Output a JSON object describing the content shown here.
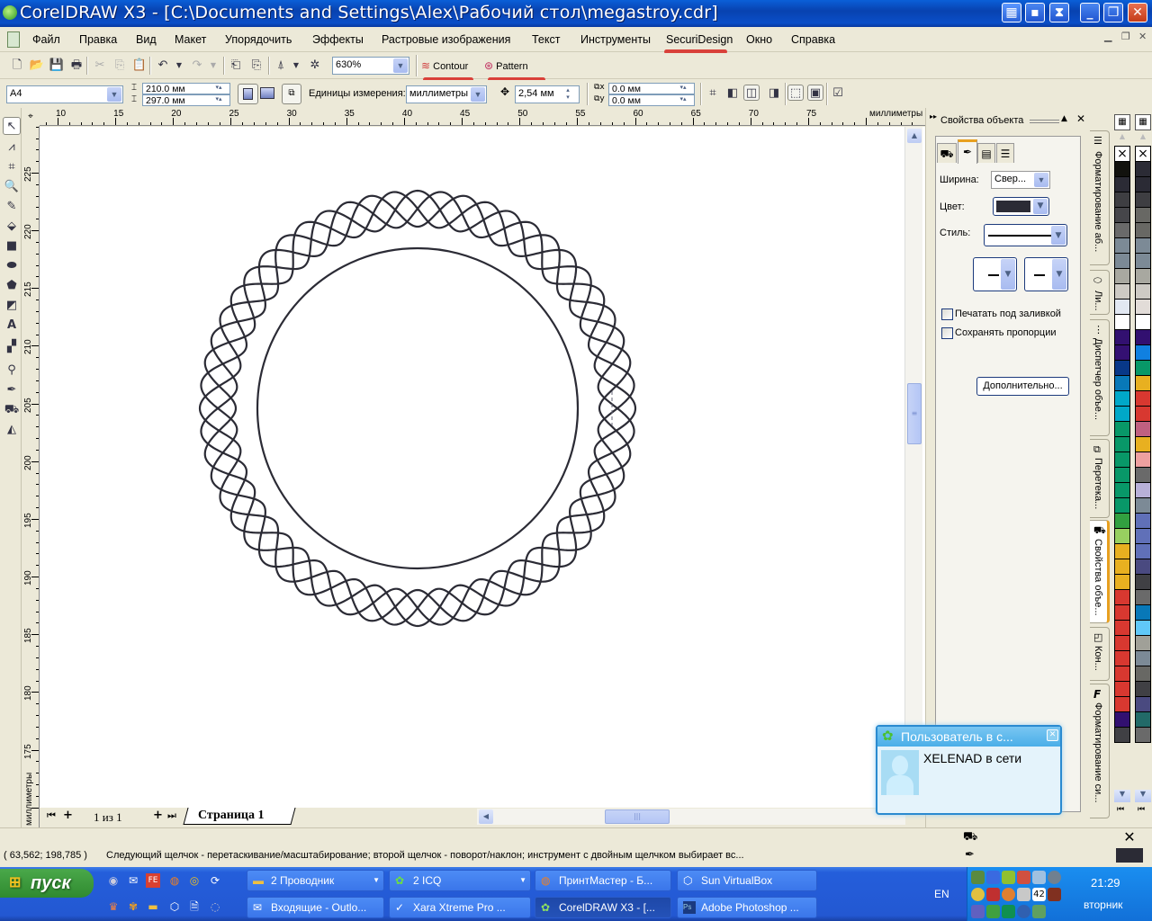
{
  "window": {
    "title": "CorelDRAW X3 - [C:\\Documents and Settings\\Alex\\Рабочий стол\\megastroy.cdr]",
    "controls": [
      "minimize",
      "restore",
      "close"
    ]
  },
  "menu": {
    "items": [
      "Файл",
      "Правка",
      "Вид",
      "Макет",
      "Упорядочить",
      "Эффекты",
      "Растровые изображения",
      "Текст",
      "Инструменты",
      "SecuriDesign",
      "Окно",
      "Справка"
    ]
  },
  "standard_toolbar": {
    "zoom_level": "630%",
    "plugin_buttons": [
      {
        "label": "Contour",
        "icon": "contour-wave-icon"
      },
      {
        "label": "Pattern",
        "icon": "pattern-globe-icon"
      }
    ]
  },
  "property_bar": {
    "paper_size": "A4",
    "width": "210.0 мм",
    "height": "297.0 мм",
    "units_label": "Единицы измерения:",
    "units_value": "миллиметры",
    "nudge": "2,54 мм",
    "dup_x": "0.0 мм",
    "dup_y": "0.0 мм"
  },
  "ruler": {
    "unit_label": "миллиметры",
    "top_ticks": [
      "10",
      "15",
      "20",
      "25",
      "30",
      "35",
      "40",
      "45",
      "50",
      "55",
      "60",
      "65",
      "70",
      "75"
    ],
    "left_ticks": [
      "225",
      "220",
      "215",
      "210",
      "205",
      "200",
      "195",
      "190",
      "185",
      "180",
      "175"
    ]
  },
  "page_nav": {
    "counter": "1 из 1",
    "page_tab": "Страница 1"
  },
  "docker": {
    "title": "Свойства объекта",
    "width_label": "Ширина:",
    "width_value": "Свер...",
    "color_label": "Цвет:",
    "color_value": "#2b2b35",
    "style_label": "Стиль:",
    "checkbox_print_under_fill": "Печатать под заливкой",
    "checkbox_keep_proportions": "Сохранять пропорции",
    "advanced_button": "Дополнительно...",
    "vertical_tabs": [
      "Форматирование аб...",
      "Ли...",
      "Диспетчер объе...",
      "Перетека...",
      "Свойства объе...",
      "Кон...",
      "Форматирование си..."
    ]
  },
  "palette": {
    "col1": [
      "#12120e",
      "#2b2b35",
      "#3e3e42",
      "#46464a",
      "#6a6a6a",
      "#7c8a96",
      "#7c8a96",
      "#a8a8a0",
      "#cdcac4",
      "#e2e8f2",
      "#ffffff",
      "#321070",
      "#341072",
      "#083888",
      "#0878b8",
      "#00a8c8",
      "#00a8c8",
      "#089868",
      "#089868",
      "#089868",
      "#089868",
      "#089868",
      "#089868",
      "#32a040",
      "#98d060",
      "#e8b020",
      "#e8b020",
      "#e8b020",
      "#d83830",
      "#d83830",
      "#d83830",
      "#d83830",
      "#d83830",
      "#d83830",
      "#d83830",
      "#d83830",
      "#321070",
      "#404044",
      "#226a68",
      "#089868"
    ],
    "col2": [
      "#2b2b35",
      "#2b2b35",
      "#3e3e42",
      "#686864",
      "#686864",
      "#7c8a96",
      "#7c8a96",
      "#a8a8a0",
      "#cdcac4",
      "#e2dcd8",
      "#ffffff",
      "#321070",
      "#1080e0",
      "#089868",
      "#e8b020",
      "#d83830",
      "#d83830",
      "#c06080",
      "#e8b020",
      "#eea0a0",
      "#6a6a6a",
      "#b8b0d8",
      "#7c8a96",
      "#6070b8",
      "#6070b8",
      "#6070b8",
      "#4a4a80",
      "#404044",
      "#6a6a6a",
      "#0878b8",
      "#60c8f8",
      "#a0a098",
      "#7c8a96",
      "#686864",
      "#404044",
      "#4a4a80",
      "#226a68",
      "#6a6a6a",
      "#089868",
      "#089868",
      "#00a8c8"
    ]
  },
  "status": {
    "coords": "( 63,562; 198,785 )",
    "message": "Следующий щелчок - перетаскивание/масштабирование; второй щелчок - поворот/наклон; инструмент с двойным щелчком выбирает вс...",
    "fill_color": "none",
    "outline_color": "#2b2b35"
  },
  "icq_popup": {
    "title": "Пользователь в с...",
    "message": "XELENAD в сети"
  },
  "taskbar": {
    "start_label": "пуск",
    "tasks_row1": [
      {
        "label": "2 Проводник",
        "icon": "folder-icon",
        "group": true
      },
      {
        "label": "2 ICQ",
        "icon": "icq-icon",
        "group": true
      },
      {
        "label": "ПринтМастер - Б...",
        "icon": "firefox-icon"
      },
      {
        "label": "Sun VirtualBox",
        "icon": "virtualbox-icon"
      }
    ],
    "tasks_row2": [
      {
        "label": "Входящие - Outlo...",
        "icon": "outlook-icon"
      },
      {
        "label": "Xara Xtreme Pro ...",
        "icon": "xara-icon"
      },
      {
        "label": "CorelDRAW X3 - [...",
        "icon": "coreldraw-icon",
        "active": true
      },
      {
        "label": "Adobe Photoshop ...",
        "icon": "photoshop-icon"
      }
    ],
    "language": "EN",
    "clock_time": "21:29",
    "clock_day": "вторник",
    "tray_badge": "42"
  },
  "drawing": {
    "stroke_color": "#2b2b35",
    "inner_circle": true,
    "guilloche_waves": 4,
    "guilloche_lobes": 14
  }
}
